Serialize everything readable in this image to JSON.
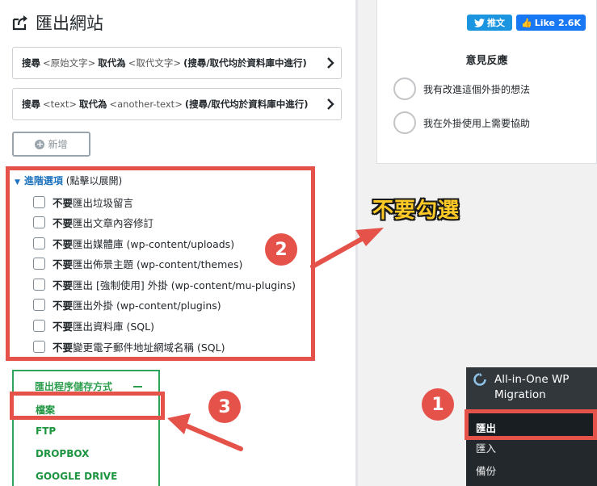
{
  "page": {
    "title": "匯出網站"
  },
  "find_replace": [
    {
      "find_label": "搜尋",
      "find_value": "<原始文字>",
      "replace_label": "取代為",
      "replace_value": "<取代文字>",
      "note": "(搜尋/取代均於資料庫中進行)"
    },
    {
      "find_label": "搜尋",
      "find_value": "<text>",
      "replace_label": "取代為",
      "replace_value": "<another-text>",
      "note": "(搜尋/取代均於資料庫中進行)"
    }
  ],
  "add_button": {
    "label": "新增"
  },
  "advanced": {
    "title": "進階選項",
    "hint": "(點擊以展開)",
    "options": [
      {
        "bold": "不要",
        "text": "匯出垃圾留言"
      },
      {
        "bold": "不要",
        "text": "匯出文章內容修訂"
      },
      {
        "bold": "不要",
        "text": "匯出媒體庫 (wp-content/uploads)"
      },
      {
        "bold": "不要",
        "text": "匯出佈景主題 (wp-content/themes)"
      },
      {
        "bold": "不要",
        "text": "匯出 [強制使用] 外掛 (wp-content/mu-plugins)"
      },
      {
        "bold": "不要",
        "text": "匯出外掛 (wp-content/plugins)"
      },
      {
        "bold": "不要",
        "text": "匯出資料庫 (SQL)"
      },
      {
        "bold": "不要",
        "text": "變更電子郵件地址網域名稱 (SQL)"
      }
    ]
  },
  "export_to": {
    "title": "匯出程序儲存方式",
    "items": [
      "檔案",
      "FTP",
      "DROPBOX",
      "GOOGLE DRIVE"
    ]
  },
  "social": {
    "tweet_label": "推文",
    "like_label": "Like",
    "like_count": "2.6K"
  },
  "feedback": {
    "title": "意見反應",
    "options": [
      "我有改進這個外掛的想法",
      "我在外掛使用上需要協助"
    ]
  },
  "annotation": {
    "text": "不要勾選",
    "badges": [
      "1",
      "2",
      "3"
    ]
  },
  "wp_menu": {
    "plugin_name_line1": "All-in-One WP",
    "plugin_name_line2": "Migration",
    "items": [
      "匯出",
      "匯入",
      "備份"
    ]
  },
  "colors": {
    "annotation_red": "#e4524a",
    "export_green": "#2e9e4f",
    "link_blue": "#1e73be",
    "callout_yellow": "#ffc926"
  }
}
